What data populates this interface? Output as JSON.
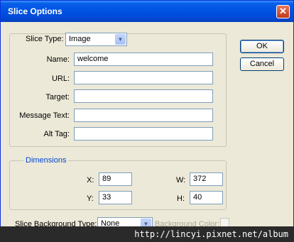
{
  "window": {
    "title": "Slice Options",
    "close_glyph": "✕"
  },
  "slice_type": {
    "label": "Slice Type:",
    "value": "Image"
  },
  "fields": [
    {
      "label": "Name:",
      "value": "welcome"
    },
    {
      "label": "URL:",
      "value": ""
    },
    {
      "label": "Target:",
      "value": ""
    },
    {
      "label": "Message Text:",
      "value": ""
    },
    {
      "label": "Alt Tag:",
      "value": ""
    }
  ],
  "buttons": {
    "ok": "OK",
    "cancel": "Cancel"
  },
  "dimensions": {
    "legend": "Dimensions",
    "x": {
      "label": "X:",
      "value": "89"
    },
    "y": {
      "label": "Y:",
      "value": "33"
    },
    "w": {
      "label": "W:",
      "value": "372"
    },
    "h": {
      "label": "H:",
      "value": "40"
    }
  },
  "background": {
    "type_label": "Slice Background Type:",
    "type_value": "None",
    "color_label": "Background Color:"
  },
  "watermark": "http://lincyi.pixnet.net/album",
  "colors": {
    "titlebar": "#0054e3",
    "dialog_bg": "#ece9d8",
    "legend_blue": "#0046d5"
  }
}
